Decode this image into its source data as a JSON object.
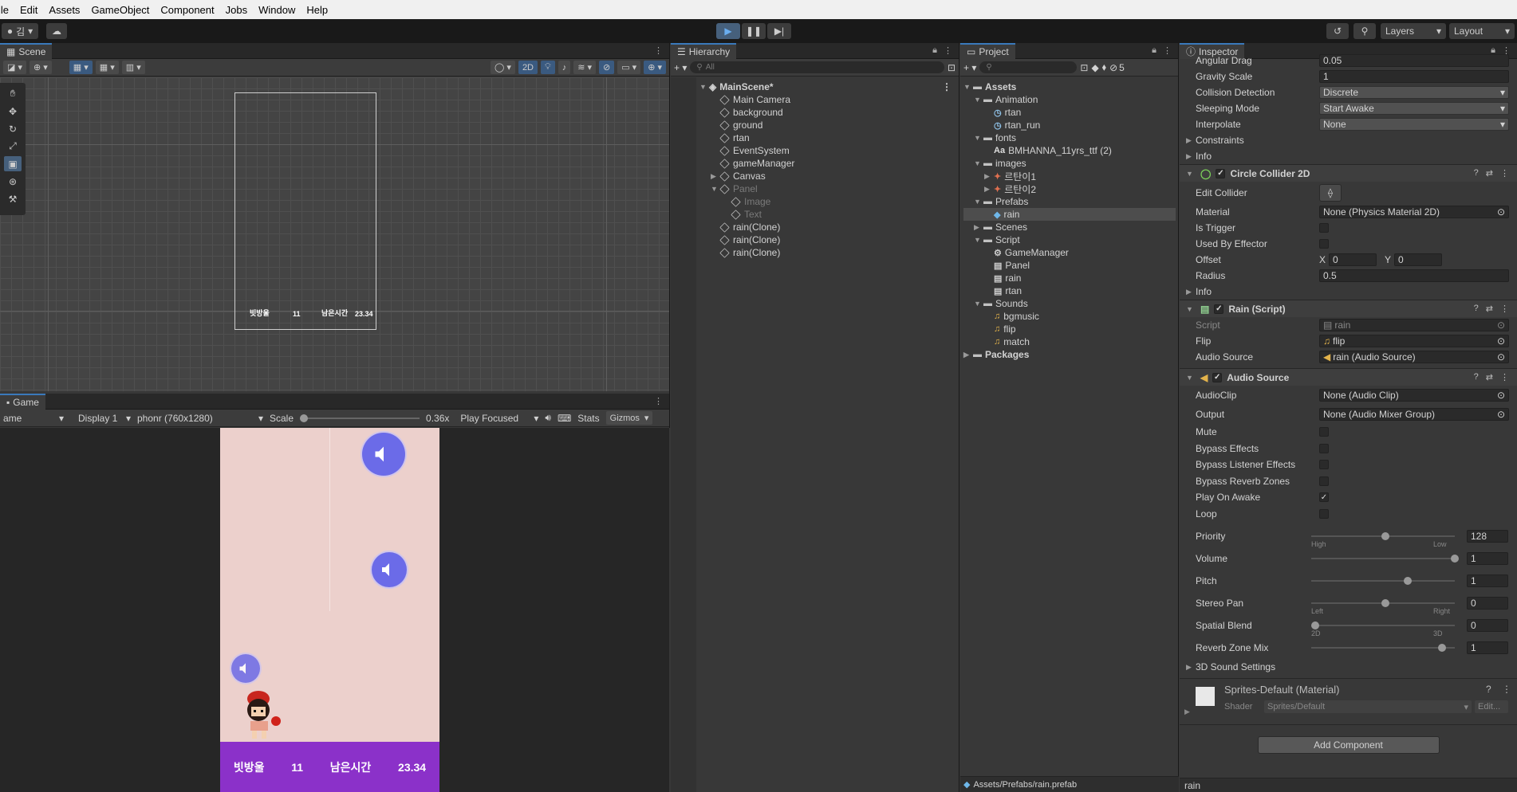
{
  "menu": [
    "ile",
    "Edit",
    "Assets",
    "GameObject",
    "Component",
    "Jobs",
    "Window",
    "Help"
  ],
  "toolbar": {
    "account": "김",
    "layers": "Layers",
    "layout": "Layout"
  },
  "scene": {
    "tab": "Scene",
    "mode_2d": "2D",
    "canvas_labels": [
      "빗방울",
      "11",
      "남은시간",
      "23.34"
    ]
  },
  "game": {
    "tab": "Game",
    "view_label": "ame",
    "display": "Display 1",
    "resolution": "phonr (760x1280)",
    "scale_label": "Scale",
    "scale_value": "0.36x",
    "play_mode": "Play Focused",
    "stats": "Stats",
    "gizmos": "Gizmos",
    "hud": [
      "빗방울",
      "11",
      "남은시간",
      "23.34"
    ]
  },
  "hierarchy": {
    "tab": "Hierarchy",
    "search_placeholder": "All",
    "scene_name": "MainScene*",
    "items": [
      {
        "label": "Main Camera",
        "dim": false,
        "indent": 1,
        "arrow": ""
      },
      {
        "label": "background",
        "dim": false,
        "indent": 1,
        "arrow": ""
      },
      {
        "label": "ground",
        "dim": false,
        "indent": 1,
        "arrow": ""
      },
      {
        "label": "rtan",
        "dim": false,
        "indent": 1,
        "arrow": ""
      },
      {
        "label": "EventSystem",
        "dim": false,
        "indent": 1,
        "arrow": ""
      },
      {
        "label": "gameManager",
        "dim": false,
        "indent": 1,
        "arrow": ""
      },
      {
        "label": "Canvas",
        "dim": false,
        "indent": 1,
        "arrow": "▶"
      },
      {
        "label": "Panel",
        "dim": true,
        "indent": 1,
        "arrow": "▼"
      },
      {
        "label": "Image",
        "dim": true,
        "indent": 2,
        "arrow": ""
      },
      {
        "label": "Text",
        "dim": true,
        "indent": 2,
        "arrow": ""
      },
      {
        "label": "rain(Clone)",
        "dim": false,
        "indent": 1,
        "arrow": ""
      },
      {
        "label": "rain(Clone)",
        "dim": false,
        "indent": 1,
        "arrow": ""
      },
      {
        "label": "rain(Clone)",
        "dim": false,
        "indent": 1,
        "arrow": ""
      }
    ]
  },
  "project": {
    "tab": "Project",
    "hidden_count": "5",
    "path": "Assets/Prefabs/rain.prefab",
    "items": [
      {
        "label": "Assets",
        "indent": 0,
        "arrow": "▼",
        "type": "folder",
        "bold": true
      },
      {
        "label": "Animation",
        "indent": 1,
        "arrow": "▼",
        "type": "folder"
      },
      {
        "label": "rtan",
        "indent": 2,
        "arrow": "",
        "type": "anim"
      },
      {
        "label": "rtan_run",
        "indent": 2,
        "arrow": "",
        "type": "anim"
      },
      {
        "label": "fonts",
        "indent": 1,
        "arrow": "▼",
        "type": "folder"
      },
      {
        "label": "BMHANNA_11yrs_ttf (2)",
        "indent": 2,
        "arrow": "",
        "type": "font"
      },
      {
        "label": "images",
        "indent": 1,
        "arrow": "▼",
        "type": "folder"
      },
      {
        "label": "르탄이1",
        "indent": 2,
        "arrow": "▶",
        "type": "image"
      },
      {
        "label": "르탄이2",
        "indent": 2,
        "arrow": "▶",
        "type": "image"
      },
      {
        "label": "Prefabs",
        "indent": 1,
        "arrow": "▼",
        "type": "folder"
      },
      {
        "label": "rain",
        "indent": 2,
        "arrow": "",
        "type": "prefab",
        "selected": true
      },
      {
        "label": "Scenes",
        "indent": 1,
        "arrow": "▶",
        "type": "folder"
      },
      {
        "label": "Script",
        "indent": 1,
        "arrow": "▼",
        "type": "folder"
      },
      {
        "label": "GameManager",
        "indent": 2,
        "arrow": "",
        "type": "gear"
      },
      {
        "label": "Panel",
        "indent": 2,
        "arrow": "",
        "type": "script"
      },
      {
        "label": "rain",
        "indent": 2,
        "arrow": "",
        "type": "script"
      },
      {
        "label": "rtan",
        "indent": 2,
        "arrow": "",
        "type": "script"
      },
      {
        "label": "Sounds",
        "indent": 1,
        "arrow": "▼",
        "type": "folder"
      },
      {
        "label": "bgmusic",
        "indent": 2,
        "arrow": "",
        "type": "audio"
      },
      {
        "label": "flip",
        "indent": 2,
        "arrow": "",
        "type": "audio"
      },
      {
        "label": "match",
        "indent": 2,
        "arrow": "",
        "type": "audio"
      },
      {
        "label": "Packages",
        "indent": 0,
        "arrow": "▶",
        "type": "folder",
        "bold": true
      }
    ]
  },
  "inspector": {
    "tab": "Inspector",
    "rigidbody": {
      "angular_drag_label": "Angular Drag",
      "angular_drag": "0.05",
      "gravity_label": "Gravity Scale",
      "gravity": "1",
      "collision_label": "Collision Detection",
      "collision": "Discrete",
      "sleeping_label": "Sleeping Mode",
      "sleeping": "Start Awake",
      "interpolate_label": "Interpolate",
      "interpolate": "None",
      "constraints": "Constraints",
      "info": "Info"
    },
    "collider": {
      "title": "Circle Collider 2D",
      "edit_label": "Edit Collider",
      "material_label": "Material",
      "material": "None (Physics Material 2D)",
      "trigger_label": "Is Trigger",
      "effector_label": "Used By Effector",
      "offset_label": "Offset",
      "offset_x_label": "X",
      "offset_x": "0",
      "offset_y_label": "Y",
      "offset_y": "0",
      "radius_label": "Radius",
      "radius": "0.5",
      "info": "Info"
    },
    "script": {
      "title": "Rain (Script)",
      "script_label": "Script",
      "script": "rain",
      "flip_label": "Flip",
      "flip": "flip",
      "audio_label": "Audio Source",
      "audio": "rain (Audio Source)"
    },
    "audio": {
      "title": "Audio Source",
      "clip_label": "AudioClip",
      "clip": "None (Audio Clip)",
      "output_label": "Output",
      "output": "None (Audio Mixer Group)",
      "toggles": [
        {
          "label": "Mute",
          "checked": false
        },
        {
          "label": "Bypass Effects",
          "checked": false
        },
        {
          "label": "Bypass Listener Effects",
          "checked": false
        },
        {
          "label": "Bypass Reverb Zones",
          "checked": false
        },
        {
          "label": "Play On Awake",
          "checked": true
        },
        {
          "label": "Loop",
          "checked": false
        }
      ],
      "sliders": [
        {
          "label": "Priority",
          "value": "128",
          "pos": 0.5,
          "min": "High",
          "max": "Low"
        },
        {
          "label": "Volume",
          "value": "1",
          "pos": 1.0,
          "min": "",
          "max": ""
        },
        {
          "label": "Pitch",
          "value": "1",
          "pos": 0.66,
          "min": "",
          "max": ""
        },
        {
          "label": "Stereo Pan",
          "value": "0",
          "pos": 0.5,
          "min": "Left",
          "max": "Right"
        },
        {
          "label": "Spatial Blend",
          "value": "0",
          "pos": 0.0,
          "min": "2D",
          "max": "3D"
        },
        {
          "label": "Reverb Zone Mix",
          "value": "1",
          "pos": 0.91,
          "min": "",
          "max": ""
        }
      ],
      "sound_settings": "3D Sound Settings"
    },
    "material": {
      "title": "Sprites-Default (Material)",
      "shader_label": "Shader",
      "shader": "Sprites/Default",
      "edit": "Edit..."
    },
    "add_component": "Add Component",
    "footer": "rain"
  }
}
